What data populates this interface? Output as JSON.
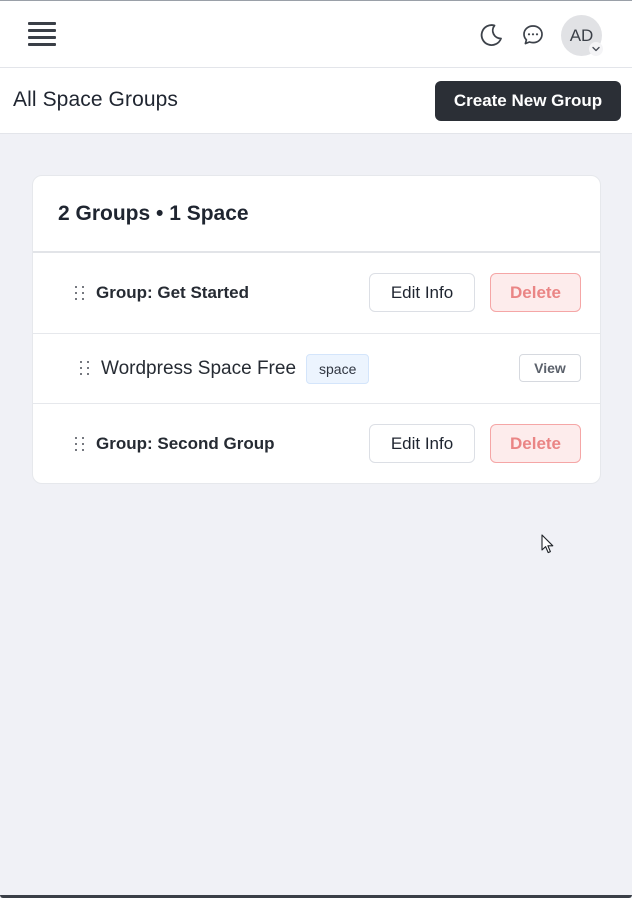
{
  "topbar": {
    "avatar_initials": "AD",
    "icons": [
      "menu-icon",
      "moon-icon",
      "chat-bubble-icon",
      "chevron-down-icon"
    ]
  },
  "header": {
    "title": "All Space Groups",
    "create_button_label": "Create New Group"
  },
  "card": {
    "summary": "2 Groups • 1 Space",
    "rows": [
      {
        "type": "group",
        "name": "Group: Get Started",
        "edit_label": "Edit Info",
        "delete_label": "Delete"
      },
      {
        "type": "space",
        "name": "Wordpress Space Free",
        "tag": "space",
        "view_label": "View"
      },
      {
        "type": "group",
        "name": "Group: Second Group",
        "edit_label": "Edit Info",
        "delete_label": "Delete"
      }
    ]
  },
  "colors": {
    "page_background": "#f0f1f6",
    "primary_button": "#2b2f36",
    "delete_text": "#ea8585",
    "delete_background": "#fdecec",
    "tag_background": "#ecf4fe"
  }
}
